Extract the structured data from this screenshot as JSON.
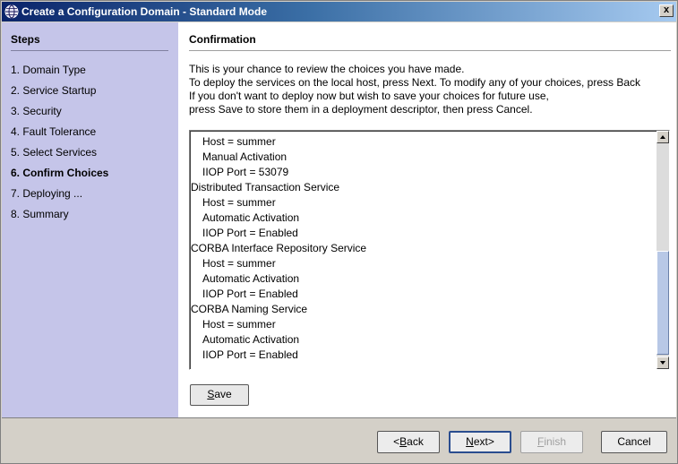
{
  "window": {
    "title": "Create a Configuration Domain - Standard Mode",
    "close_label": "x"
  },
  "sidebar": {
    "title": "Steps",
    "items": [
      {
        "label": "1. Domain Type",
        "current": false
      },
      {
        "label": "2. Service Startup",
        "current": false
      },
      {
        "label": "3. Security",
        "current": false
      },
      {
        "label": "4. Fault Tolerance",
        "current": false
      },
      {
        "label": "5. Select Services",
        "current": false
      },
      {
        "label": "6. Confirm Choices",
        "current": true
      },
      {
        "label": "7. Deploying ...",
        "current": false
      },
      {
        "label": "8. Summary",
        "current": false
      }
    ]
  },
  "main": {
    "title": "Confirmation",
    "intro": [
      "This is your chance to review the choices you have made.",
      "To deploy the services on the local host, press Next. To modify any of your choices, press Back",
      "If you don't want to deploy now but wish to save your choices for future use,",
      "press Save to store them in a deployment descriptor, then press Cancel."
    ],
    "review_lines": [
      {
        "text": "Host = summer",
        "indent": true
      },
      {
        "text": "Manual Activation",
        "indent": true
      },
      {
        "text": "IIOP Port = 53079",
        "indent": true
      },
      {
        "text": "Distributed Transaction Service",
        "indent": false
      },
      {
        "text": "Host = summer",
        "indent": true
      },
      {
        "text": "Automatic Activation",
        "indent": true
      },
      {
        "text": "IIOP Port = Enabled",
        "indent": true
      },
      {
        "text": "CORBA Interface Repository Service",
        "indent": false
      },
      {
        "text": "Host = summer",
        "indent": true
      },
      {
        "text": "Automatic Activation",
        "indent": true
      },
      {
        "text": "IIOP Port = Enabled",
        "indent": true
      },
      {
        "text": "CORBA Naming Service",
        "indent": false
      },
      {
        "text": "Host = summer",
        "indent": true
      },
      {
        "text": "Automatic Activation",
        "indent": true
      },
      {
        "text": "IIOP Port = Enabled",
        "indent": true
      }
    ],
    "save_button": {
      "mnemonic": "S",
      "rest": "ave"
    }
  },
  "footer": {
    "back": {
      "prefix": "<",
      "mnemonic": "B",
      "rest": "ack"
    },
    "next": {
      "mnemonic": "N",
      "rest": "ext>"
    },
    "finish": {
      "mnemonic": "F",
      "rest": "inish"
    },
    "cancel": "Cancel"
  },
  "colors": {
    "title_gradient_start": "#0a246a",
    "sidebar_bg": "#c5c5e9",
    "scroll_thumb": "#b8c8e6"
  },
  "icons": {
    "app": "globe-icon",
    "close": "close-icon"
  }
}
